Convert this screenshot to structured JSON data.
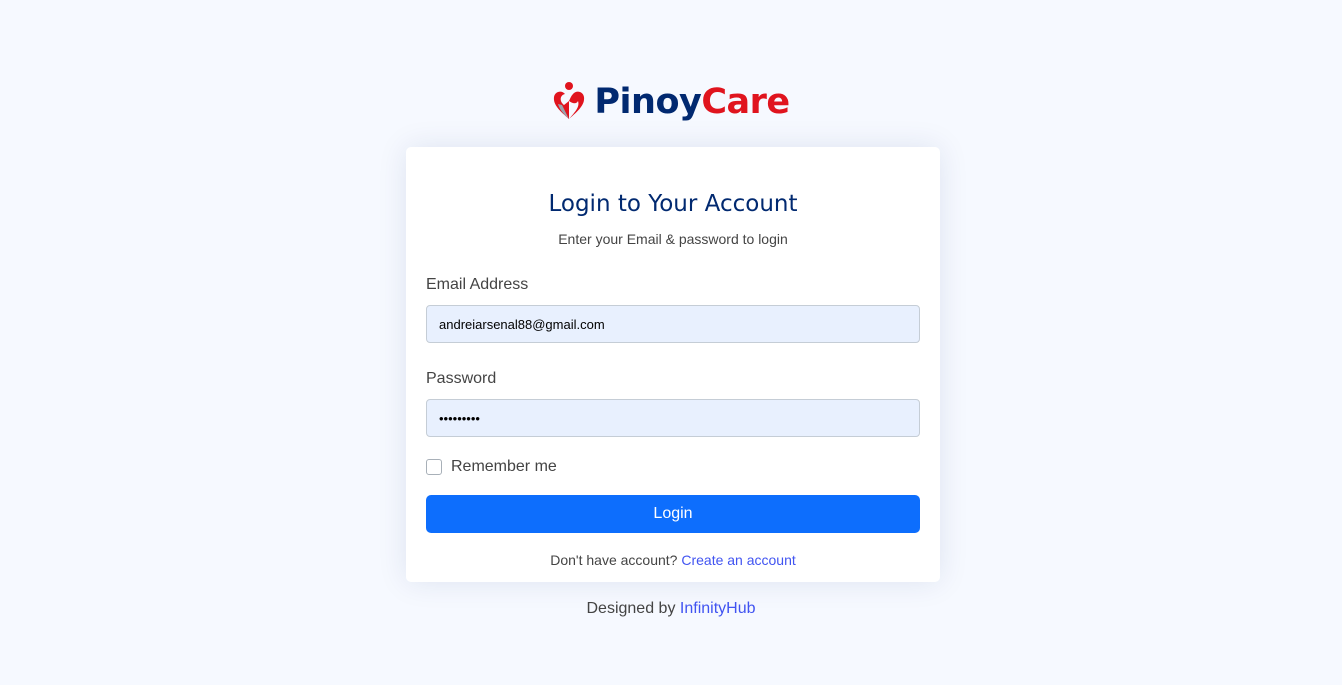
{
  "brand": {
    "logo_icon": "heart-care-icon",
    "name_part1": "Pinoy",
    "name_part2": "Care",
    "colors": {
      "primary": "#012970",
      "accent": "#e0141e"
    }
  },
  "card": {
    "title": "Login to Your Account",
    "subtitle": "Enter your Email & password to login"
  },
  "form": {
    "email": {
      "label": "Email Address",
      "value": "andreiarsenal88@gmail.com"
    },
    "password": {
      "label": "Password",
      "value": "•••••••••"
    },
    "remember": {
      "label": "Remember me",
      "checked": false
    },
    "submit_label": "Login",
    "button_color": "#0d6efd"
  },
  "signup": {
    "prompt": "Don't have account?",
    "link_label": "Create an account"
  },
  "footer": {
    "prefix": "Designed by",
    "link_label": "InfinityHub"
  }
}
